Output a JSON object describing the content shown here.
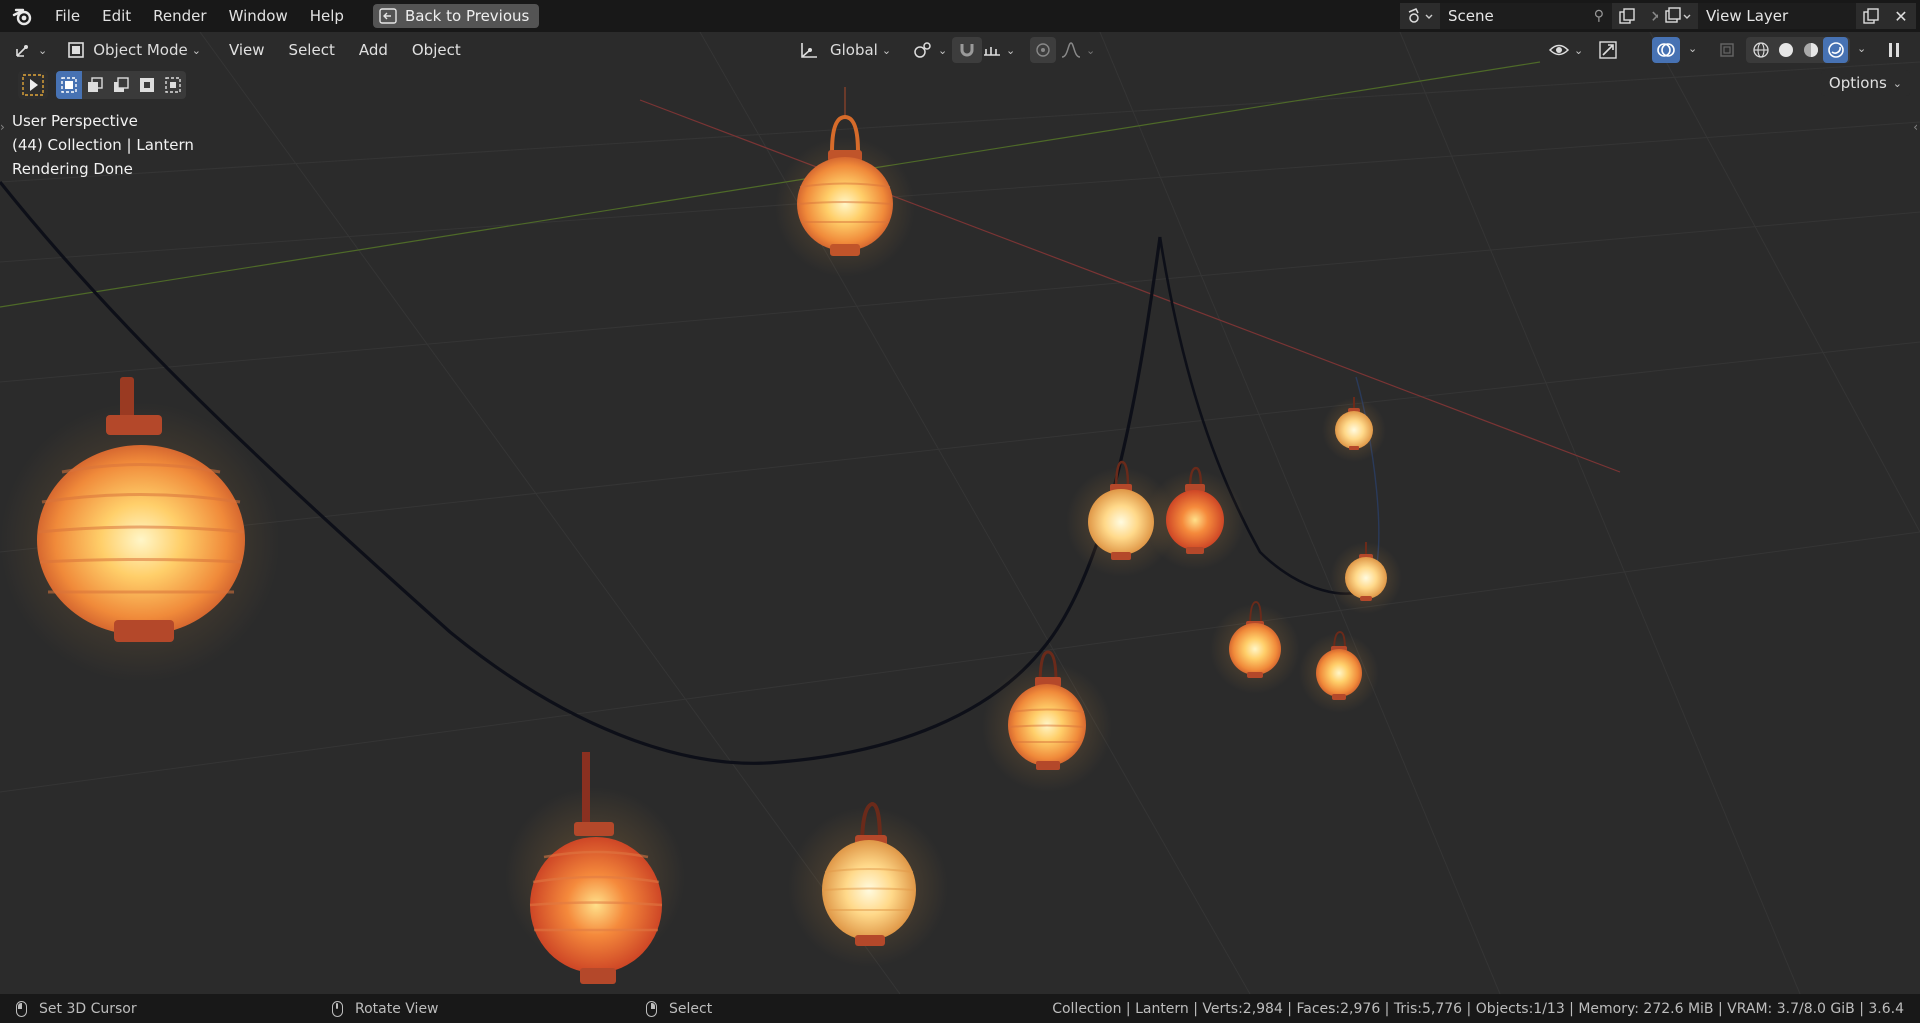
{
  "menu": {
    "items": [
      "File",
      "Edit",
      "Render",
      "Window",
      "Help"
    ],
    "back_button": "Back to Previous"
  },
  "scene": {
    "label": "Scene",
    "view_layer": "View Layer"
  },
  "viewport_header": {
    "mode": "Object Mode",
    "menus": [
      "View",
      "Select",
      "Add",
      "Object"
    ],
    "orientation": "Global",
    "options": "Options"
  },
  "overlay": {
    "perspective": "User Perspective",
    "collection": "(44) Collection | Lantern",
    "status": "Rendering Done"
  },
  "statusbar": {
    "left_hint": "Set 3D Cursor",
    "middle_hint": "Rotate View",
    "right_hint": "Select",
    "stats": "Collection | Lantern | Verts:2,984 | Faces:2,976 | Tris:5,776 | Objects:1/13 | Memory: 272.6 MiB | VRAM: 3.7/8.0 GiB | 3.6.4"
  },
  "colors": {
    "viewport_bg": "#2b2b2b",
    "x_axis": "#8c3a3a",
    "y_axis": "#5a7a2c",
    "accent_blue": "#4772b3"
  }
}
